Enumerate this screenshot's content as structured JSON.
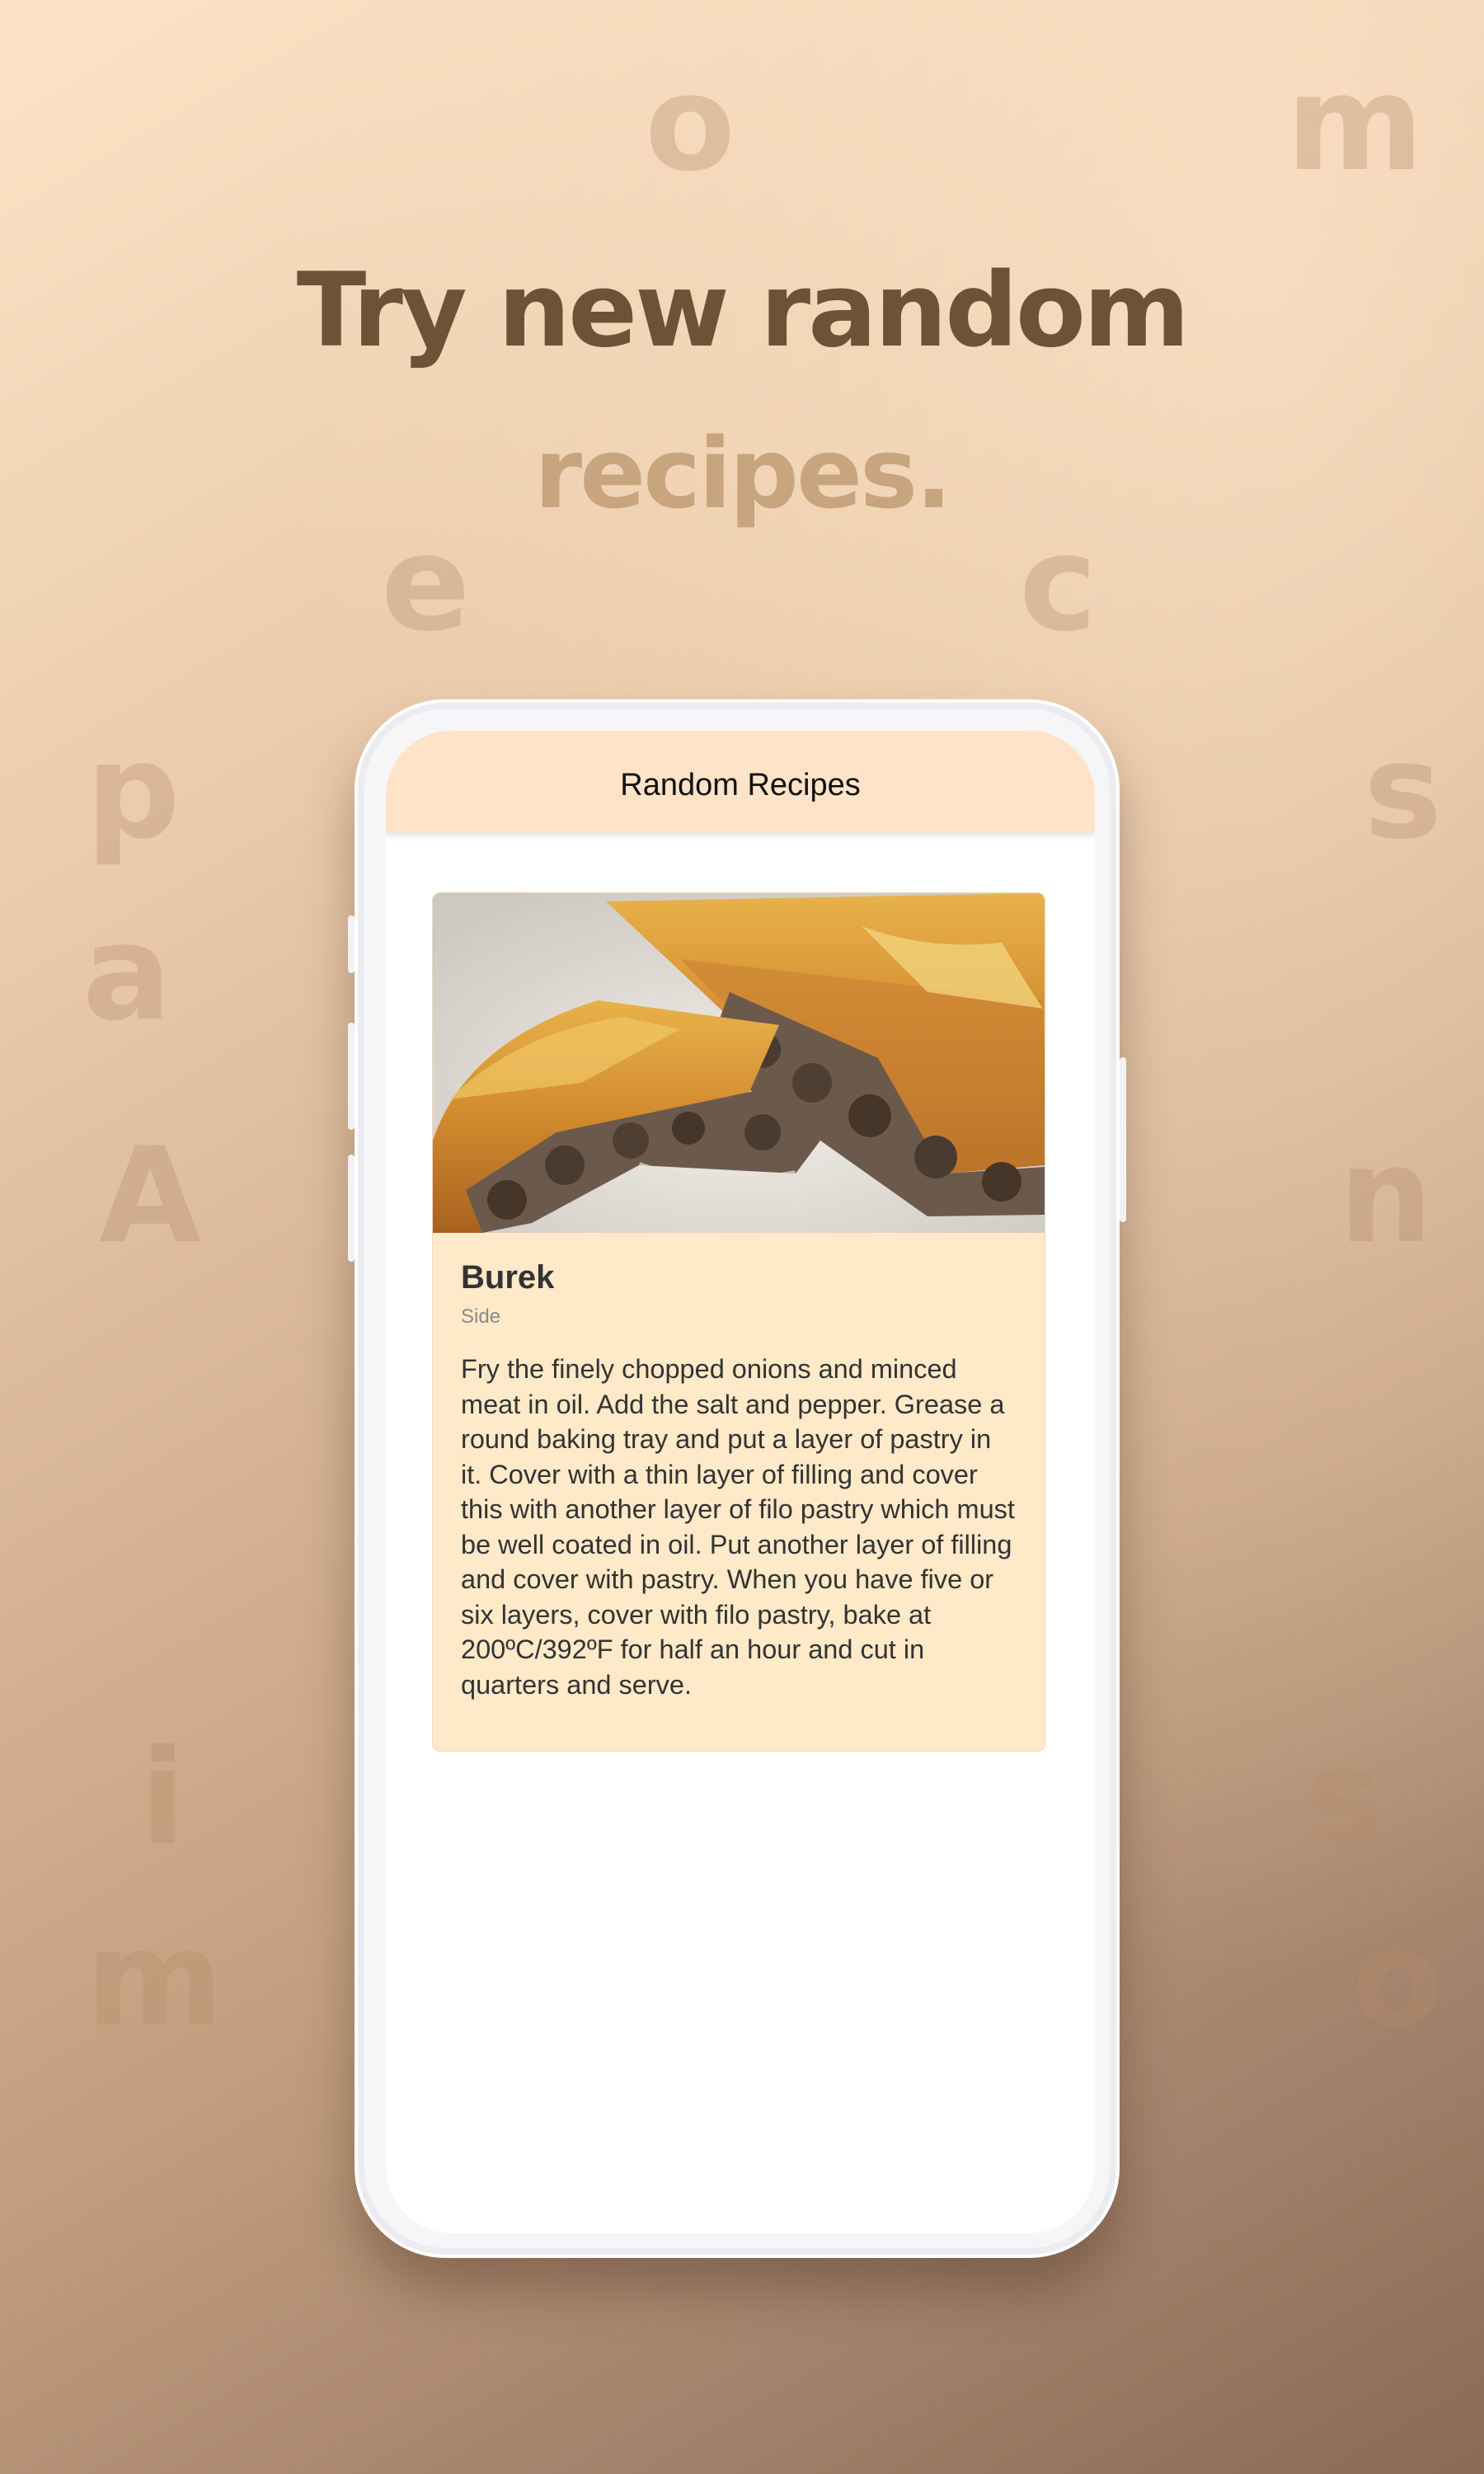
{
  "background": {
    "letters": [
      "o",
      "m",
      "e",
      "c",
      "p",
      "s",
      "a",
      "A",
      "n",
      "i",
      "s",
      "m",
      "o"
    ],
    "headline_line1": "Try new random",
    "headline_line2": "recipes.",
    "colors": {
      "headline_primary": "#6e5235",
      "headline_secondary": "#c8a57f",
      "header_bg": "#fee3c8",
      "card_bg": "#fee9c8"
    }
  },
  "app": {
    "title": "Random Recipes"
  },
  "recipe": {
    "image_alt": "food-photo",
    "name": "Burek",
    "category": "Side",
    "instructions": "Fry the finely chopped onions and minced meat in oil. Add the salt and pepper. Grease a round baking tray and put a layer of pastry in it. Cover with a thin layer of filling and cover this with another layer of filo pastry which must be well coated in oil. Put another layer of filling and cover with pastry. When you have five or six layers, cover with filo pastry, bake at 200ºC/392ºF for half an hour and cut in quarters and serve."
  }
}
